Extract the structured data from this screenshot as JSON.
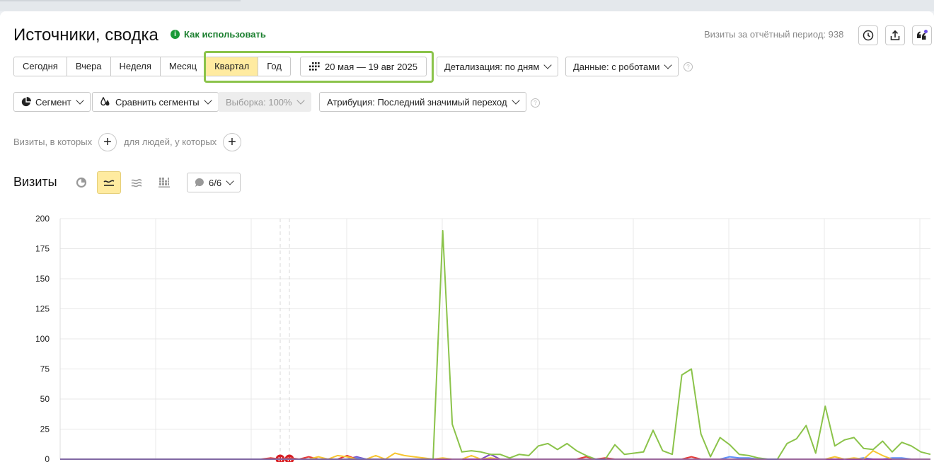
{
  "header": {
    "title": "Источники, сводка",
    "help_link": "Как использовать",
    "visits_total": "Визиты за отчётный период: 938"
  },
  "period_tabs": [
    "Сегодня",
    "Вчера",
    "Неделя",
    "Месяц",
    "Квартал",
    "Год"
  ],
  "active_period": "Квартал",
  "date_range": "20 мая — 19 авг 2025",
  "detail_dropdown": "Детализация: по дням",
  "data_dropdown": "Данные: с роботами",
  "segment_button": "Сегмент",
  "compare_button": "Сравнить сегменты",
  "sample_button": "Выборка: 100%",
  "attribution_button": "Атрибуция: Последний значимый переход",
  "filters": {
    "visits_label": "Визиты, в которых",
    "people_label": "для людей, у которых"
  },
  "chart_header": {
    "title": "Визиты",
    "series_counter": "6/6"
  },
  "holiday_markers": [
    "H",
    "H"
  ],
  "colors": {
    "green_series": "#8bc34a",
    "yellow_series": "#f7c531",
    "red_series": "#e53935",
    "blue_series": "#5b8ff9",
    "purple_series": "#7e4bc2",
    "active_bg": "#ffeba0",
    "highlight_frame": "#8bc34a"
  },
  "chart_data": {
    "type": "line",
    "ylim": [
      0,
      200
    ],
    "yticks": [
      0,
      25,
      50,
      75,
      100,
      125,
      150,
      175,
      200
    ],
    "x_count": 92,
    "series": [
      {
        "color": "#8bc34a",
        "values": [
          0,
          0,
          0,
          0,
          0,
          0,
          0,
          0,
          0,
          0,
          0,
          0,
          0,
          0,
          0,
          0,
          0,
          0,
          0,
          0,
          0,
          0,
          0,
          0,
          0,
          0,
          0,
          0,
          0,
          0,
          0,
          0,
          0,
          0,
          0,
          0,
          0,
          0,
          0,
          0,
          190,
          29,
          6,
          7,
          6,
          4,
          4,
          1,
          4,
          3,
          11,
          13,
          8,
          13,
          7,
          3,
          0,
          0,
          12,
          4,
          5,
          6,
          24,
          7,
          4,
          70,
          75,
          21,
          2,
          18,
          12,
          4,
          3,
          1,
          0,
          0,
          13,
          17,
          28,
          5,
          44,
          11,
          16,
          18,
          9,
          8,
          15,
          6,
          14,
          11,
          6,
          4,
          5,
          8,
          16,
          12,
          0
        ]
      },
      {
        "color": "#f7c531",
        "values": [
          0,
          0,
          0,
          0,
          0,
          0,
          0,
          0,
          0,
          0,
          0,
          0,
          0,
          0,
          0,
          0,
          0,
          0,
          0,
          0,
          0,
          0,
          0,
          0,
          0,
          0,
          0,
          2,
          0,
          3,
          2,
          0,
          0,
          3,
          0,
          5,
          3,
          2,
          1,
          0,
          1,
          0,
          0,
          3,
          0,
          1,
          0,
          0,
          0,
          0,
          0,
          0,
          0,
          0,
          0,
          0,
          0,
          0,
          0,
          0,
          0,
          0,
          0,
          0,
          0,
          0,
          0,
          0,
          0,
          0,
          0,
          0,
          0,
          0,
          0,
          0,
          0,
          0,
          0,
          0,
          0,
          2,
          0,
          1,
          0,
          7,
          3,
          0,
          0,
          0,
          0,
          0,
          0,
          1,
          0,
          0,
          2,
          0
        ]
      },
      {
        "color": "#e53935",
        "values": [
          0,
          0,
          0,
          0,
          0,
          0,
          0,
          0,
          0,
          0,
          0,
          0,
          0,
          0,
          0,
          0,
          0,
          0,
          0,
          0,
          0,
          0,
          1,
          0,
          1,
          0,
          2,
          0,
          0,
          0,
          3,
          0,
          0,
          0,
          0,
          0,
          0,
          0,
          0,
          0,
          0,
          0,
          0,
          0,
          0,
          0,
          0,
          0,
          0,
          0,
          0,
          0,
          0,
          0,
          0,
          2,
          0,
          1,
          0,
          0,
          0,
          0,
          0,
          0,
          0,
          0,
          2,
          0,
          0,
          0,
          0,
          0,
          0,
          0,
          0,
          0,
          0,
          0,
          0,
          0,
          0,
          0,
          0,
          0,
          0,
          0,
          0,
          0,
          0,
          0,
          0,
          0,
          0,
          0,
          0,
          0,
          0,
          0
        ]
      },
      {
        "color": "#5b8ff9",
        "values": [
          0,
          0,
          0,
          0,
          0,
          0,
          0,
          0,
          0,
          0,
          0,
          0,
          0,
          0,
          0,
          0,
          0,
          0,
          0,
          0,
          0,
          0,
          0,
          0,
          0,
          0,
          0,
          0,
          0,
          0,
          0,
          1,
          0,
          0,
          0,
          0,
          0,
          0,
          0,
          0,
          0,
          0,
          0,
          0,
          0,
          0,
          0,
          0,
          0,
          0,
          0,
          0,
          0,
          0,
          0,
          0,
          0,
          0,
          0,
          0,
          0,
          0,
          0,
          0,
          0,
          0,
          0,
          0,
          0,
          0,
          2,
          1,
          1,
          0,
          0,
          0,
          0,
          0,
          0,
          0,
          0,
          0,
          0,
          0,
          1,
          0,
          0,
          1,
          1,
          0,
          0,
          0,
          0,
          0,
          0,
          0,
          0,
          0
        ]
      },
      {
        "color": "#7e4bc2",
        "values": [
          0,
          0,
          0,
          0,
          0,
          0,
          0,
          0,
          0,
          0,
          0,
          0,
          0,
          0,
          0,
          0,
          0,
          0,
          0,
          0,
          0,
          0,
          0,
          0,
          0,
          0,
          0,
          0,
          0,
          0,
          0,
          2,
          0,
          0,
          0,
          0,
          0,
          0,
          0,
          0,
          0,
          0,
          0,
          0,
          0,
          4,
          0,
          0,
          0,
          0,
          0,
          0,
          0,
          0,
          0,
          0,
          0,
          0,
          0,
          0,
          0,
          0,
          0,
          0,
          0,
          0,
          0,
          0,
          0,
          0,
          0,
          0,
          0,
          0,
          0,
          0,
          0,
          0,
          0,
          0,
          0,
          0,
          0,
          0,
          0,
          0,
          0,
          0,
          0,
          0,
          0,
          0,
          0,
          0,
          0,
          0,
          0,
          0
        ]
      }
    ]
  }
}
